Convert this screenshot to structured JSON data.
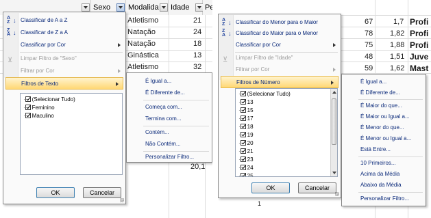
{
  "left": {
    "header": {
      "sexo": "Sexo",
      "modalidade": "Modalida",
      "idade": "Idade",
      "pe": "Pe"
    },
    "cells": {
      "modalidade": [
        "Atletismo",
        "Natação",
        "Natação",
        "Ginástica",
        "Atletismo"
      ],
      "idade": [
        "21",
        "24",
        "18",
        "13",
        "32"
      ],
      "extra_value": "20,1"
    },
    "menu": {
      "sort_az": "Classificar de A a Z",
      "sort_za": "Classificar de Z a A",
      "sort_color": "Classificar por Cor",
      "clear_filter": "Limpar Filtro de \"Sexo\"",
      "filter_color": "Filtrar por Cor",
      "text_filters": "Filtros de Texto",
      "list": [
        "(Selecionar Tudo)",
        "Feminino",
        "Maculino"
      ],
      "ok": "OK",
      "cancel": "Cancelar"
    },
    "submenu": [
      "É Igual a...",
      "É Diferente de...",
      "Começa com...",
      "Termina com...",
      "Contém...",
      "Não Contém...",
      "Personalizar Filtro..."
    ]
  },
  "right": {
    "cells": {
      "idade": [
        "67",
        "78",
        "75",
        "48",
        "59"
      ],
      "altura": [
        "1,7",
        "1,82",
        "1,88",
        "1,51",
        "1,62"
      ],
      "profissao": [
        "Profi",
        "Profi",
        "Profi",
        "Juve",
        "Mast"
      ]
    },
    "menu": {
      "sort_asc": "Classificar do Menor para o Maior",
      "sort_desc": "Classificar do Maior para o Menor",
      "sort_color": "Classificar por Cor",
      "clear_filter": "Limpar Filtro de \"Idade\"",
      "filter_color": "Filtrar por Cor",
      "number_filters": "Filtros de Número",
      "list": [
        "(Selecionar Tudo)",
        "13",
        "15",
        "17",
        "18",
        "19",
        "20",
        "21",
        "23",
        "24",
        "25"
      ],
      "ok": "OK",
      "cancel": "Cancelar",
      "below_value": "1"
    },
    "submenu": [
      "É Igual a...",
      "É Diferente de...",
      "É Maior do que...",
      "É Maior ou Igual a...",
      "É Menor do que...",
      "É Menor ou Igual a...",
      "Está Entre...",
      "10 Primeiros...",
      "Acima da Média",
      "Abaixo da Média",
      "Personalizar Filtro..."
    ]
  }
}
